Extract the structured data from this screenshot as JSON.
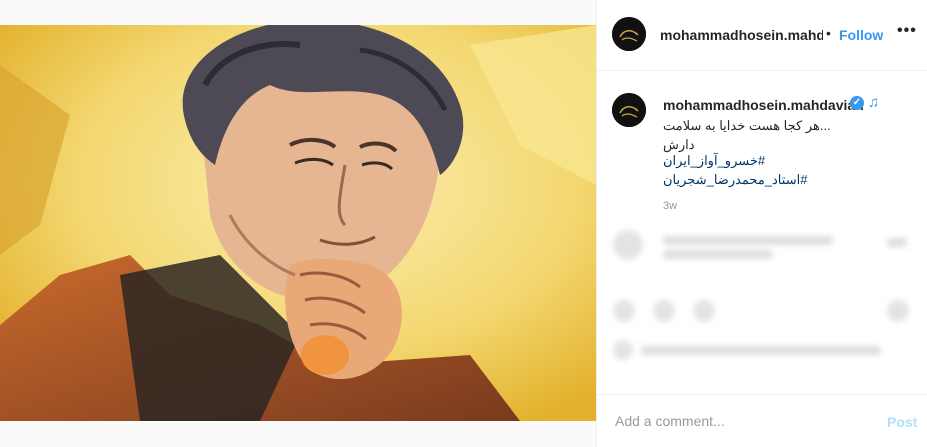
{
  "post": {
    "username": "mohammadhosein.mahdavian",
    "header_username": "mohammadhosein.mahdavian",
    "follow_label": "Follow",
    "separator": "•",
    "more_label": "•••",
    "caption_text": "...هر کجا هست خدایا به سلامت دارش",
    "caption_dot": ".",
    "hashtags": [
      "#خسرو_آواز_ایران",
      "#استاد_محمدرضا_شجریان"
    ],
    "timestamp": "3w",
    "verified_mark": "✓",
    "note_icon": "♫",
    "comment_placeholder": "Add a comment...",
    "post_label": "Post"
  },
  "icons": {
    "verified": "verified-badge-icon",
    "note": "music-note-icon",
    "more": "more-options-icon"
  },
  "colors": {
    "accent": "#3897f0",
    "hashtag": "#003569",
    "post_disabled": "#b2dffc"
  }
}
